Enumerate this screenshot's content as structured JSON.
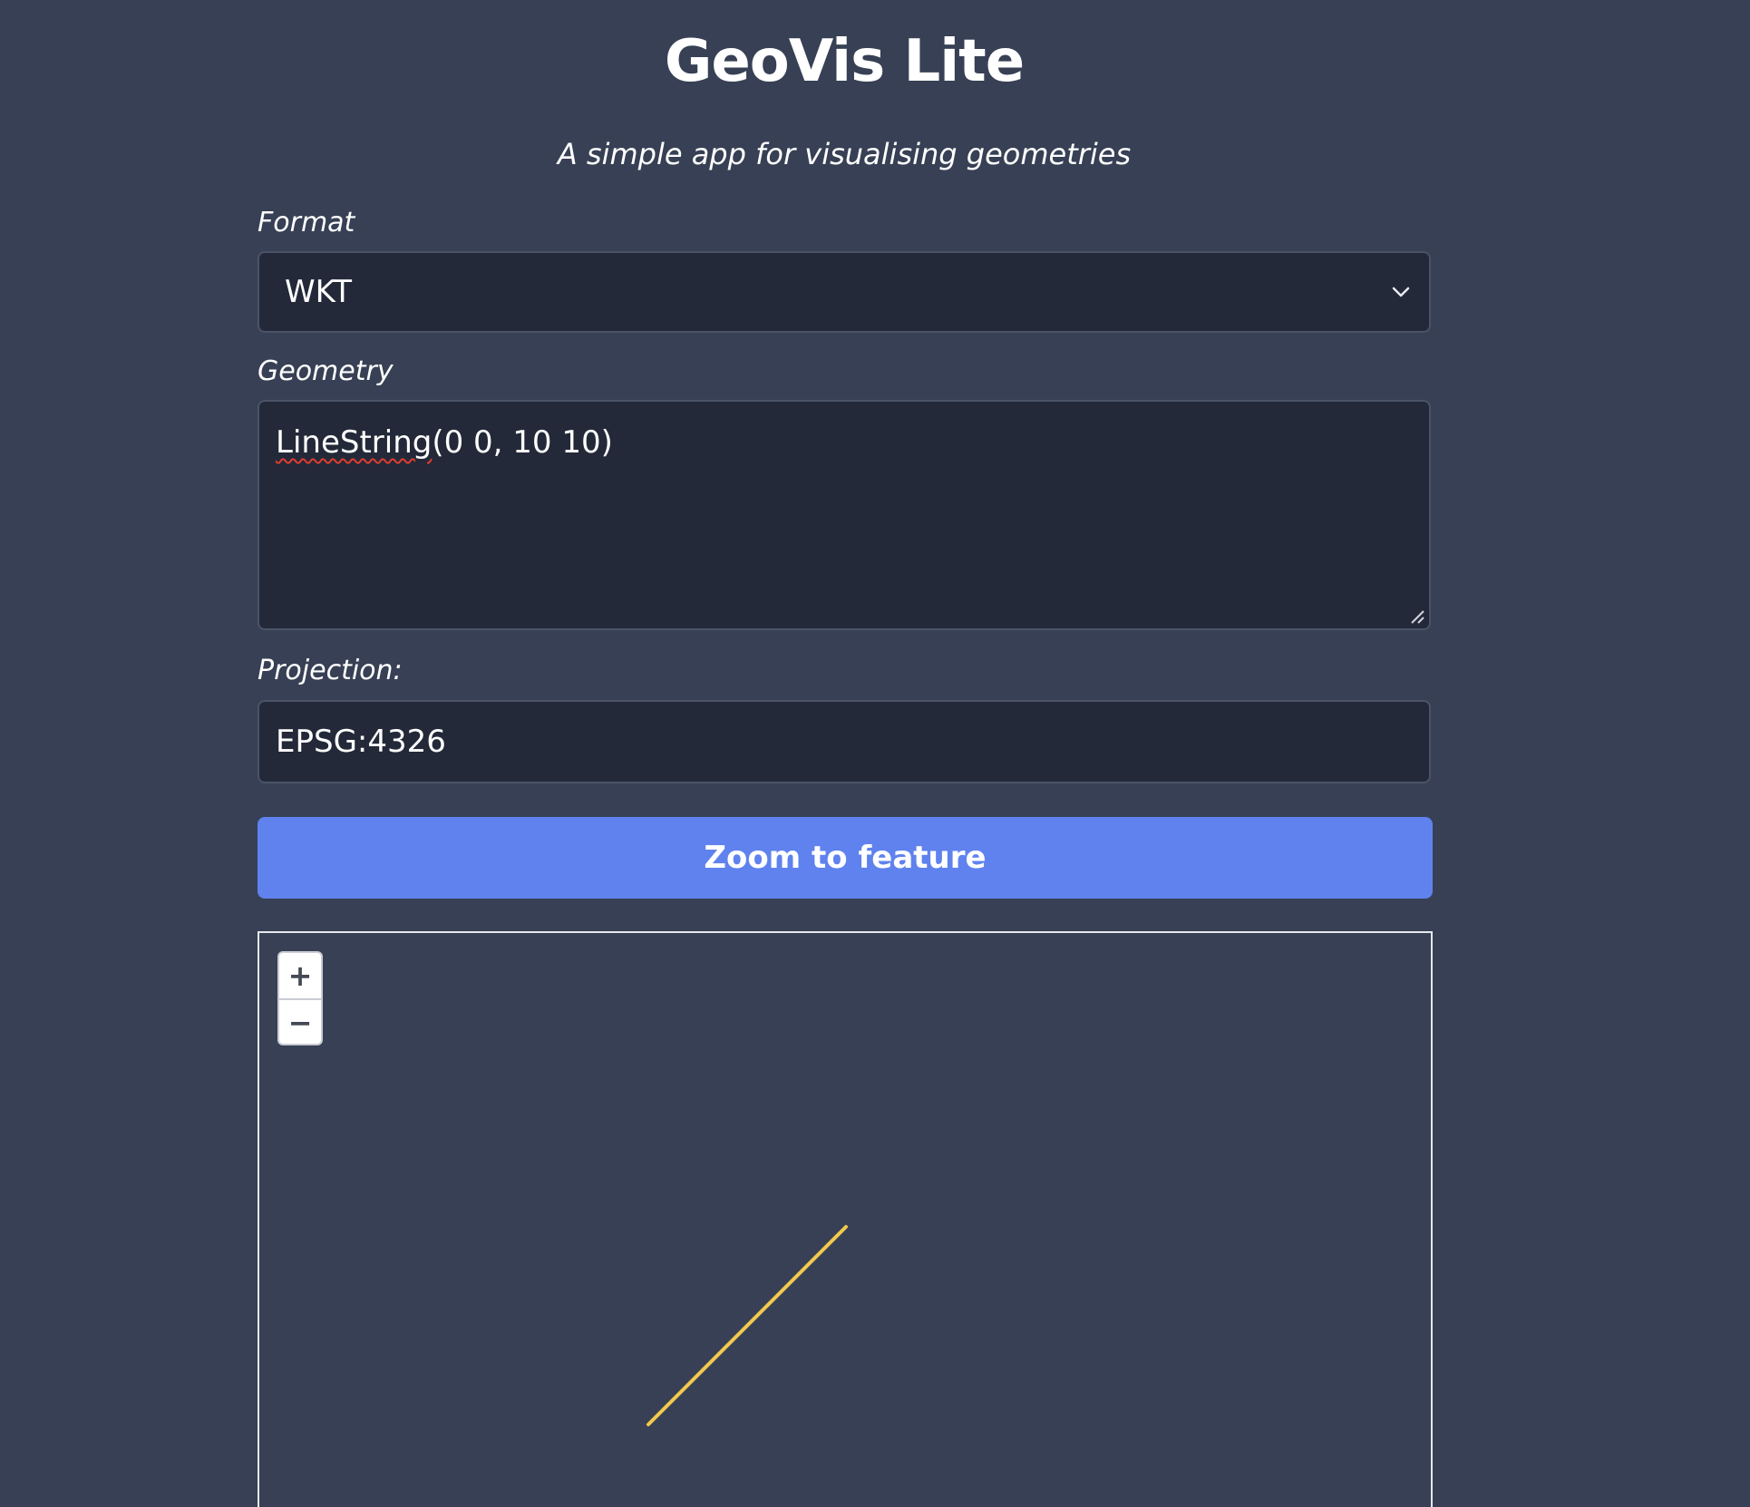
{
  "header": {
    "title": "GeoVis Lite",
    "subtitle": "A simple app for visualising geometries"
  },
  "form": {
    "format": {
      "label": "Format",
      "selected": "WKT"
    },
    "geometry": {
      "label": "Geometry",
      "value_misspelled_word": "LineString",
      "value_rest": "(0 0, 10 10)"
    },
    "projection": {
      "label": "Projection:",
      "value": "EPSG:4326"
    },
    "submit_label": "Zoom to feature"
  },
  "map": {
    "zoom_in_label": "+",
    "zoom_out_label": "−",
    "feature": {
      "type": "LineString",
      "coordinates": [
        [
          0,
          0
        ],
        [
          10,
          10
        ]
      ],
      "stroke_color": "#f2c94c"
    },
    "background_color": "#374054"
  },
  "colors": {
    "page_background": "#374054",
    "field_background": "#232938",
    "button_background": "#5f82ee"
  }
}
